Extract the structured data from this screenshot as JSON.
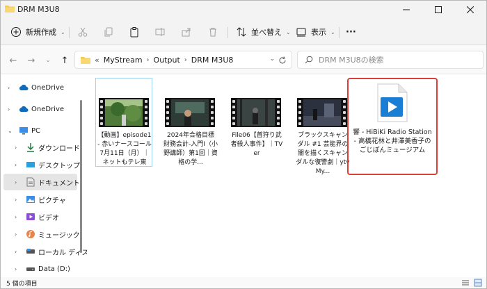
{
  "window": {
    "title": "DRM M3U8"
  },
  "toolbar": {
    "new_label": "新規作成",
    "sort_label": "並べ替え",
    "view_label": "表示",
    "more_label": "···"
  },
  "address": {
    "overflow": "«",
    "crumbs": [
      "MyStream",
      "Output",
      "DRM M3U8"
    ],
    "search_placeholder": "DRM M3U8の検索"
  },
  "sidebar": {
    "items": [
      {
        "label": "OneDrive",
        "icon": "cloud-icon"
      },
      {
        "label": "OneDrive",
        "icon": "cloud-icon"
      },
      {
        "label": "PC",
        "icon": "pc-icon"
      },
      {
        "label": "ダウンロード",
        "icon": "download-icon"
      },
      {
        "label": "デスクトップ",
        "icon": "desktop-icon"
      },
      {
        "label": "ドキュメント",
        "icon": "document-icon"
      },
      {
        "label": "ピクチャ",
        "icon": "pictures-icon"
      },
      {
        "label": "ビデオ",
        "icon": "videos-icon"
      },
      {
        "label": "ミュージック",
        "icon": "music-icon"
      },
      {
        "label": "ローカル ディスク (",
        "icon": "disk-icon"
      },
      {
        "label": "Data (D:)",
        "icon": "disk-icon"
      }
    ]
  },
  "files": [
    {
      "name": "【動画】episode1 - 赤いナースコール 7月11日（月）｜ネットもテレ東",
      "thumb": "green"
    },
    {
      "name": "2024年合格目標 財務会計-入門Ⅰ（小野講師）第1回｜資格の学...",
      "thumb": "class"
    },
    {
      "name": "File06【首狩り武者殺人事件】｜TVer",
      "thumb": "dark"
    },
    {
      "name": "ブラックスキャンダル #1 芸能界の闇を描くスキャンダルな復讐劇｜ytv My...",
      "thumb": "street"
    },
    {
      "name": "響 - HiBiKi Radio Station - 高橋花林と井澤美香子のごじぽんミュージアム",
      "thumb": "wmv"
    }
  ],
  "status": {
    "count": "5 個の項目"
  },
  "colors": {
    "accent": "#0067c0",
    "highlight_border": "#d9403a",
    "selection_border": "#9ed1f5"
  }
}
